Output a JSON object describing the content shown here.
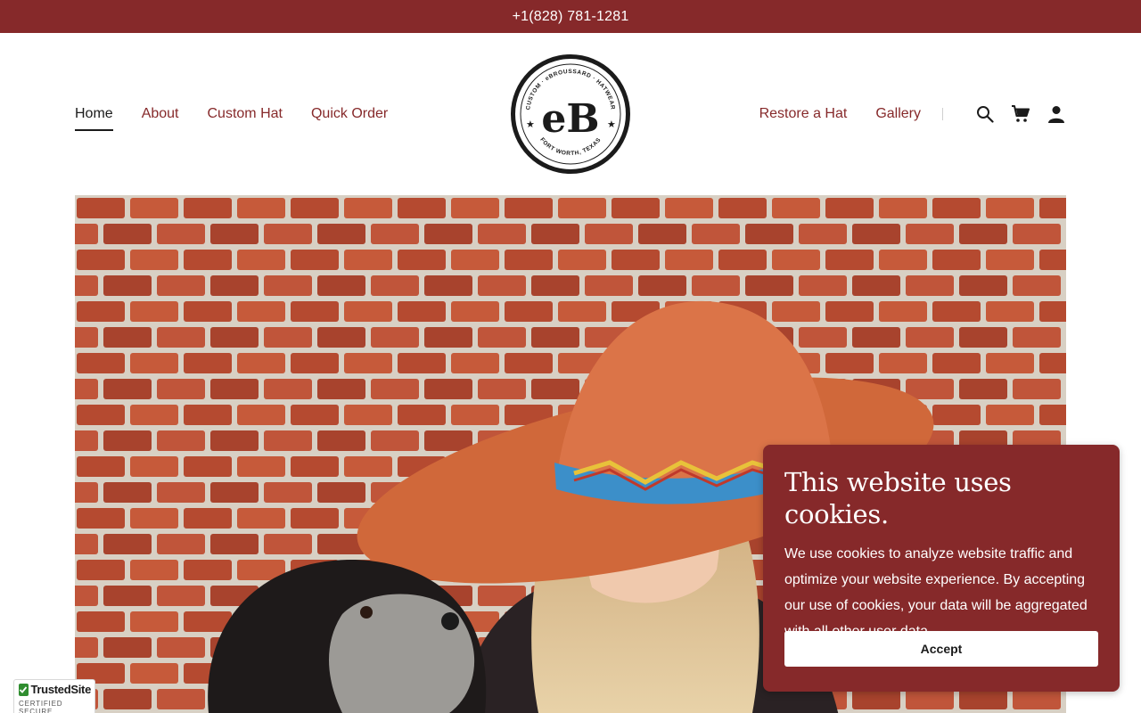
{
  "topbar": {
    "phone": "+1(828) 781-1281"
  },
  "nav": {
    "left": [
      {
        "label": "Home",
        "active": true
      },
      {
        "label": "About"
      },
      {
        "label": "Custom Hat"
      },
      {
        "label": "Quick Order"
      }
    ],
    "right": [
      {
        "label": "Restore a Hat"
      },
      {
        "label": "Gallery"
      }
    ],
    "icons": [
      "search-icon",
      "cart-icon",
      "account-icon"
    ]
  },
  "logo": {
    "monogram": "eB",
    "ring_top": "CUSTOM · eBROUSSARD · HATWEAR",
    "ring_bottom": "FORT WORTH, TEXAS"
  },
  "cookie": {
    "title": "This website uses cookies.",
    "body": "We use cookies to analyze website traffic and optimize your website experience. By accepting our use of cookies, your data will be aggregated with all other user data.",
    "accept_label": "Accept"
  },
  "badge": {
    "title": "TrustedSite",
    "subtitle": "CERTIFIED SECURE"
  },
  "colors": {
    "brand": "#86292a",
    "text": "#1b1b1b"
  }
}
